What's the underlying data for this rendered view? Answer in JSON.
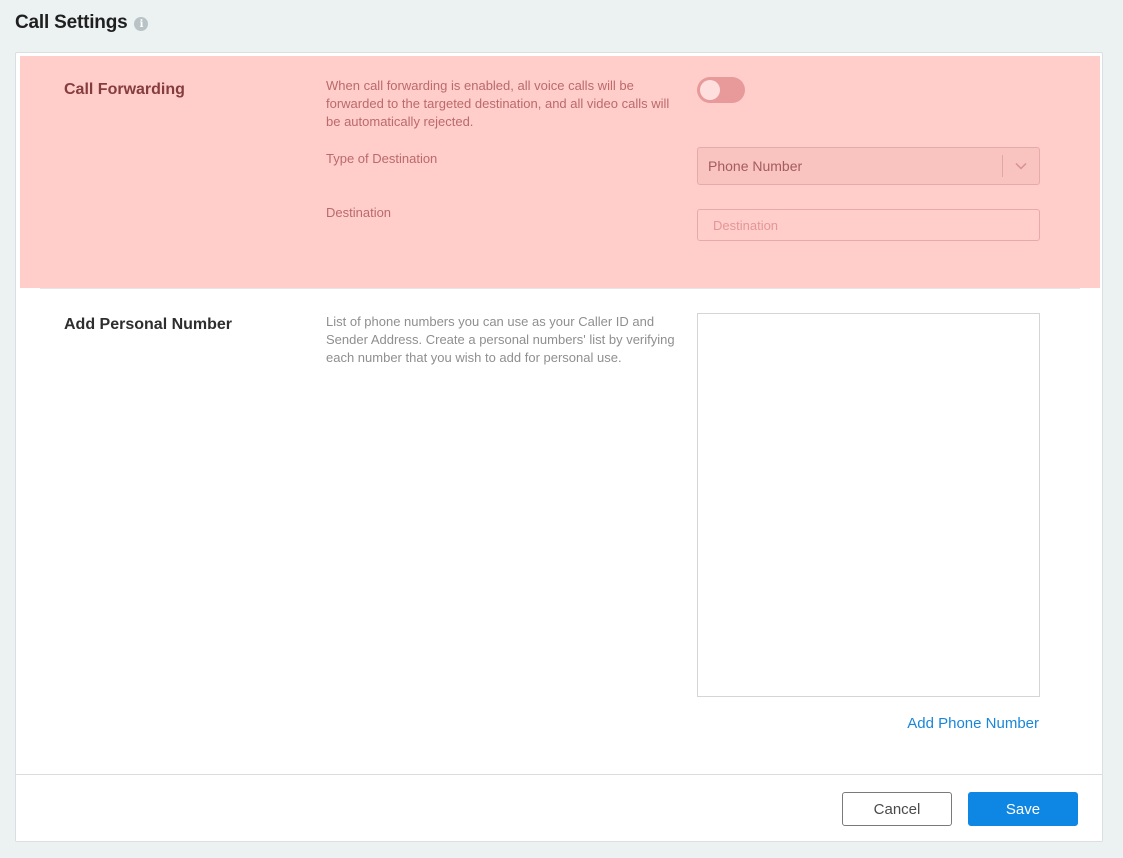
{
  "header": {
    "title": "Call Settings",
    "info_icon": "i"
  },
  "call_forwarding": {
    "label": "Call Forwarding",
    "description": "When call forwarding is enabled, all voice calls will be forwarded to the targeted destination, and all video calls will be automatically rejected.",
    "enabled": false,
    "type_label": "Type of Destination",
    "type_value": "Phone Number",
    "destination_label": "Destination",
    "destination_placeholder": "Destination",
    "destination_value": ""
  },
  "personal_number": {
    "label": "Add Personal Number",
    "description": "List of phone numbers you can use as your Caller ID and Sender Address. Create a personal numbers' list by verifying each number that you wish to add for personal use.",
    "numbers": [],
    "add_link": "Add Phone Number"
  },
  "footer": {
    "cancel_label": "Cancel",
    "save_label": "Save"
  },
  "colors": {
    "highlight": "#ffcdca",
    "primary": "#0e86e3",
    "link": "#1a86d9"
  }
}
